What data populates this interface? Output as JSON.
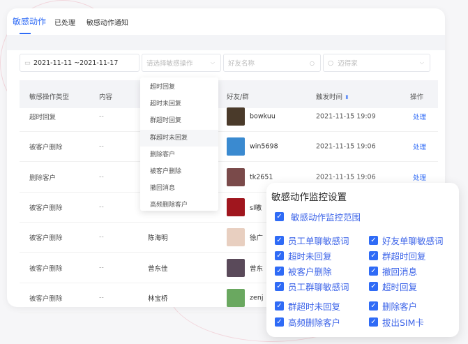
{
  "tabs": [
    "敏感动作",
    "已处理",
    "敏感动作通知"
  ],
  "filters": {
    "date": "2021-11-11 ~2021-11-17",
    "action_placeholder": "请选择敏感操作",
    "friend_placeholder": "好友名称",
    "staff_placeholder": "迈得家"
  },
  "columns": [
    "敏感操作类型",
    "内容",
    "好友/群",
    "触发时间",
    "操作"
  ],
  "rows": [
    {
      "type": "超时回复",
      "content": "--",
      "staff": "",
      "friend": "bowkuu",
      "time": "2021-11-15 19:09",
      "action": "处理",
      "color": "#4a3a2a"
    },
    {
      "type": "被客户删除",
      "content": "--",
      "staff": "",
      "friend": "win5698",
      "time": "2021-11-15 19:06",
      "action": "处理",
      "color": "#3a8ad0"
    },
    {
      "type": "删除客户",
      "content": "--",
      "staff": "",
      "friend": "tk2651",
      "time": "2021-11-15 19:06",
      "action": "处理",
      "color": "#7a4a4a"
    },
    {
      "type": "被客户删除",
      "content": "--",
      "staff": "",
      "friend": "sl嗷",
      "time": "",
      "action": "",
      "color": "#a0161e"
    },
    {
      "type": "被客户删除",
      "content": "--",
      "staff": "陈海明",
      "friend": "徐广",
      "time": "",
      "action": "",
      "color": "#e8cfc0"
    },
    {
      "type": "被客户删除",
      "content": "--",
      "staff": "曾东佳",
      "friend": "曾东",
      "time": "",
      "action": "",
      "color": "#5a4a5a"
    },
    {
      "type": "被客户删除",
      "content": "--",
      "staff": "林宝桥",
      "friend": "zenj",
      "time": "",
      "action": "",
      "color": "#6aa860"
    }
  ],
  "dropdown": [
    "超时回复",
    "超时未回复",
    "群超时回复",
    "群超时未回复",
    "删除客户",
    "被客户删除",
    "撤回消息",
    "高频删除客户"
  ],
  "panel": {
    "title": "敏感动作监控设置",
    "scope": "敏感动作监控范围",
    "left": [
      "员工单聊敏感词",
      "超时未回复",
      "被客户删除",
      "员工群聊敏感词",
      "群超时未回复",
      "高频删除客户"
    ],
    "right": [
      "好友单聊敏感词",
      "群超时回复",
      "撤回消息",
      "超时回复",
      "删除客户",
      "拔出SIM卡"
    ]
  },
  "accent": "#2f6bf6"
}
